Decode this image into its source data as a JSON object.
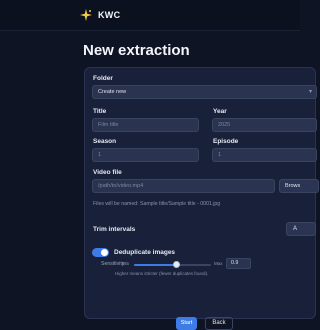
{
  "app": {
    "brand": "KWC"
  },
  "page": {
    "title": "New extraction"
  },
  "form": {
    "folder": {
      "label": "Folder",
      "value": "Create new"
    },
    "title": {
      "label": "Title",
      "placeholder": "Film title"
    },
    "year": {
      "label": "Year",
      "placeholder": "2025"
    },
    "season": {
      "label": "Season",
      "value": "1"
    },
    "episode": {
      "label": "Episode",
      "value": "1"
    },
    "video_file": {
      "label": "Video file",
      "placeholder": "/path/to/video.mp4",
      "browse_label": "Brows"
    },
    "naming_hint": "Files will be named: Sample title/Sample title - 0001.jpg",
    "trim": {
      "label": "Trim intervals",
      "button_label": "A"
    },
    "dedupe": {
      "label": "Deduplicate images",
      "enabled": true,
      "sensitivity_label": "Sensitivity:",
      "min_label": "Min",
      "max_label": "Max",
      "level": 0.55,
      "value": "0.9",
      "hint": "Higher means stricter (fewer duplicates found)."
    },
    "actions": {
      "start_label": "Start",
      "back_label": "Back"
    }
  },
  "colors": {
    "accent": "#3d7ce6",
    "background": "#0e1424",
    "card": "#19213a"
  },
  "icons": {
    "logo": "sparkle-icon"
  }
}
